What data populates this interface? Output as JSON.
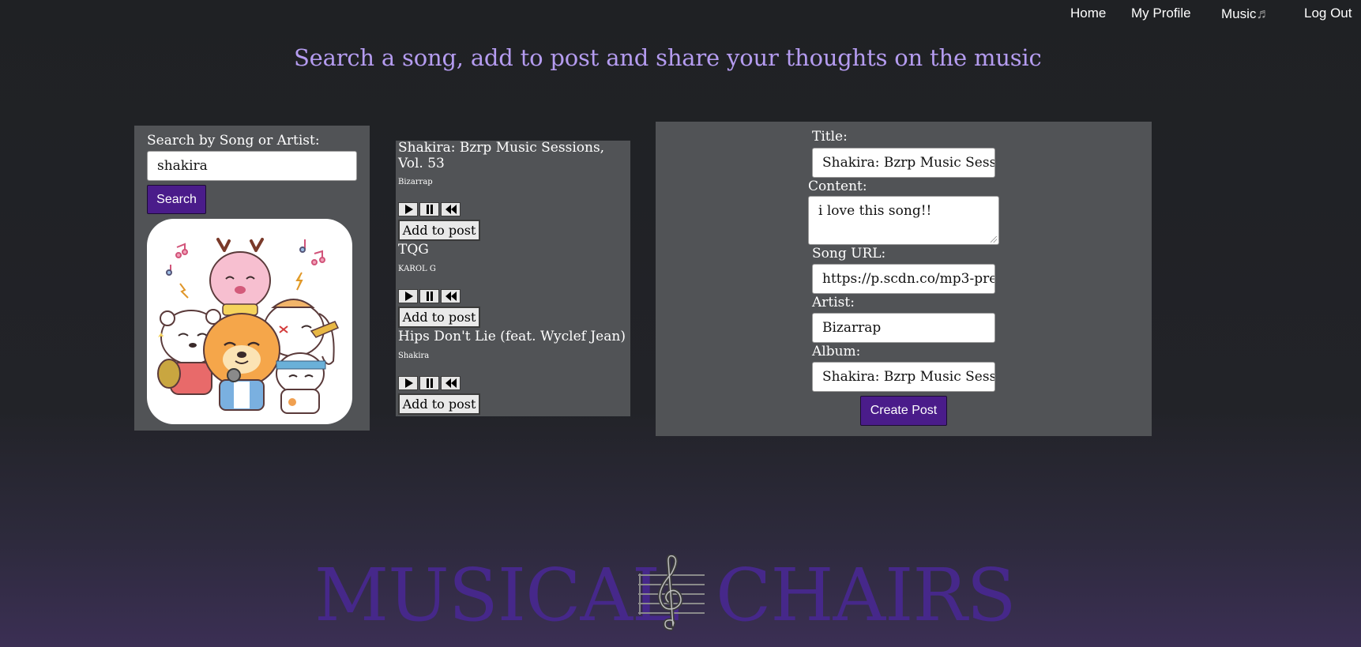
{
  "nav": {
    "home": "Home",
    "profile": "My Profile",
    "music": "Music",
    "music_icon": "♬",
    "logout": "Log Out"
  },
  "headline": "Search a song, add to post and share your thoughts on the music",
  "search": {
    "label": "Search by Song or Artist:",
    "value": "shakira",
    "button": "Search"
  },
  "results": [
    {
      "title": "Shakira: Bzrp Music Sessions, Vol. 53",
      "artist": "Bizarrap",
      "add_label": "Add to post"
    },
    {
      "title": "TQG",
      "artist": "KAROL G",
      "add_label": "Add to post"
    },
    {
      "title": "Hips Don't Lie (feat. Wyclef Jean)",
      "artist": "Shakira",
      "add_label": "Add to post"
    }
  ],
  "form": {
    "title_label": "Title:",
    "title_value": "Shakira: Bzrp Music Sessio",
    "content_label": "Content:",
    "content_value": "i love this song!!",
    "url_label": "Song URL:",
    "url_value": "https://p.scdn.co/mp3-pre",
    "artist_label": "Artist:",
    "artist_value": "Bizarrap",
    "album_label": "Album:",
    "album_value": "Shakira: Bzrp Music Sessio",
    "submit": "Create Post"
  },
  "logo": {
    "word1": "MUSICAL",
    "word2": "CHAIRS"
  },
  "colors": {
    "accent": "#4a1c8a",
    "headline": "#b59cf0",
    "panel": "#515356",
    "logo": "#46288a"
  }
}
